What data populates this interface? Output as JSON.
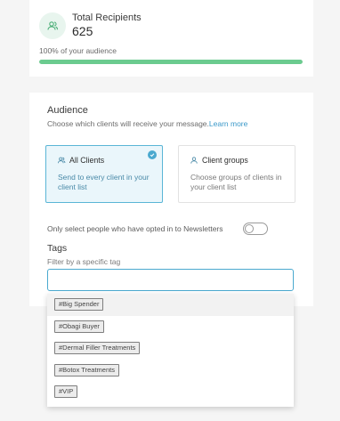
{
  "recipients": {
    "title": "Total Recipients",
    "count": "625",
    "subtitle": "100% of your audience",
    "progress": 1.0,
    "icon": "users-icon",
    "accent": "#6bcb8f"
  },
  "audience": {
    "title": "Audience",
    "subtitle": "Choose which clients will receive your message.",
    "learn_more": "Learn more",
    "options": [
      {
        "label": "All Clients",
        "description": "Send to every client in your client list",
        "icon": "users-icon",
        "selected": true
      },
      {
        "label": "Client groups",
        "description": "Choose groups of clients in your client list",
        "icon": "user-icon",
        "selected": false
      }
    ],
    "newsletter_label": "Only select people who have opted in to Newsletters",
    "newsletter_enabled": false
  },
  "tags": {
    "title": "Tags",
    "subtitle": "Filter by a specific tag",
    "input_value": "",
    "suggestions": [
      "#Big Spender",
      "#Obagi Buyer",
      "#Dermal Filler Treatments",
      "#Botox Treatments",
      "#VIP"
    ]
  },
  "colors": {
    "link": "#3a98c9",
    "selected_border": "#5ab6d6",
    "selected_bg": "#eaf6fb"
  }
}
